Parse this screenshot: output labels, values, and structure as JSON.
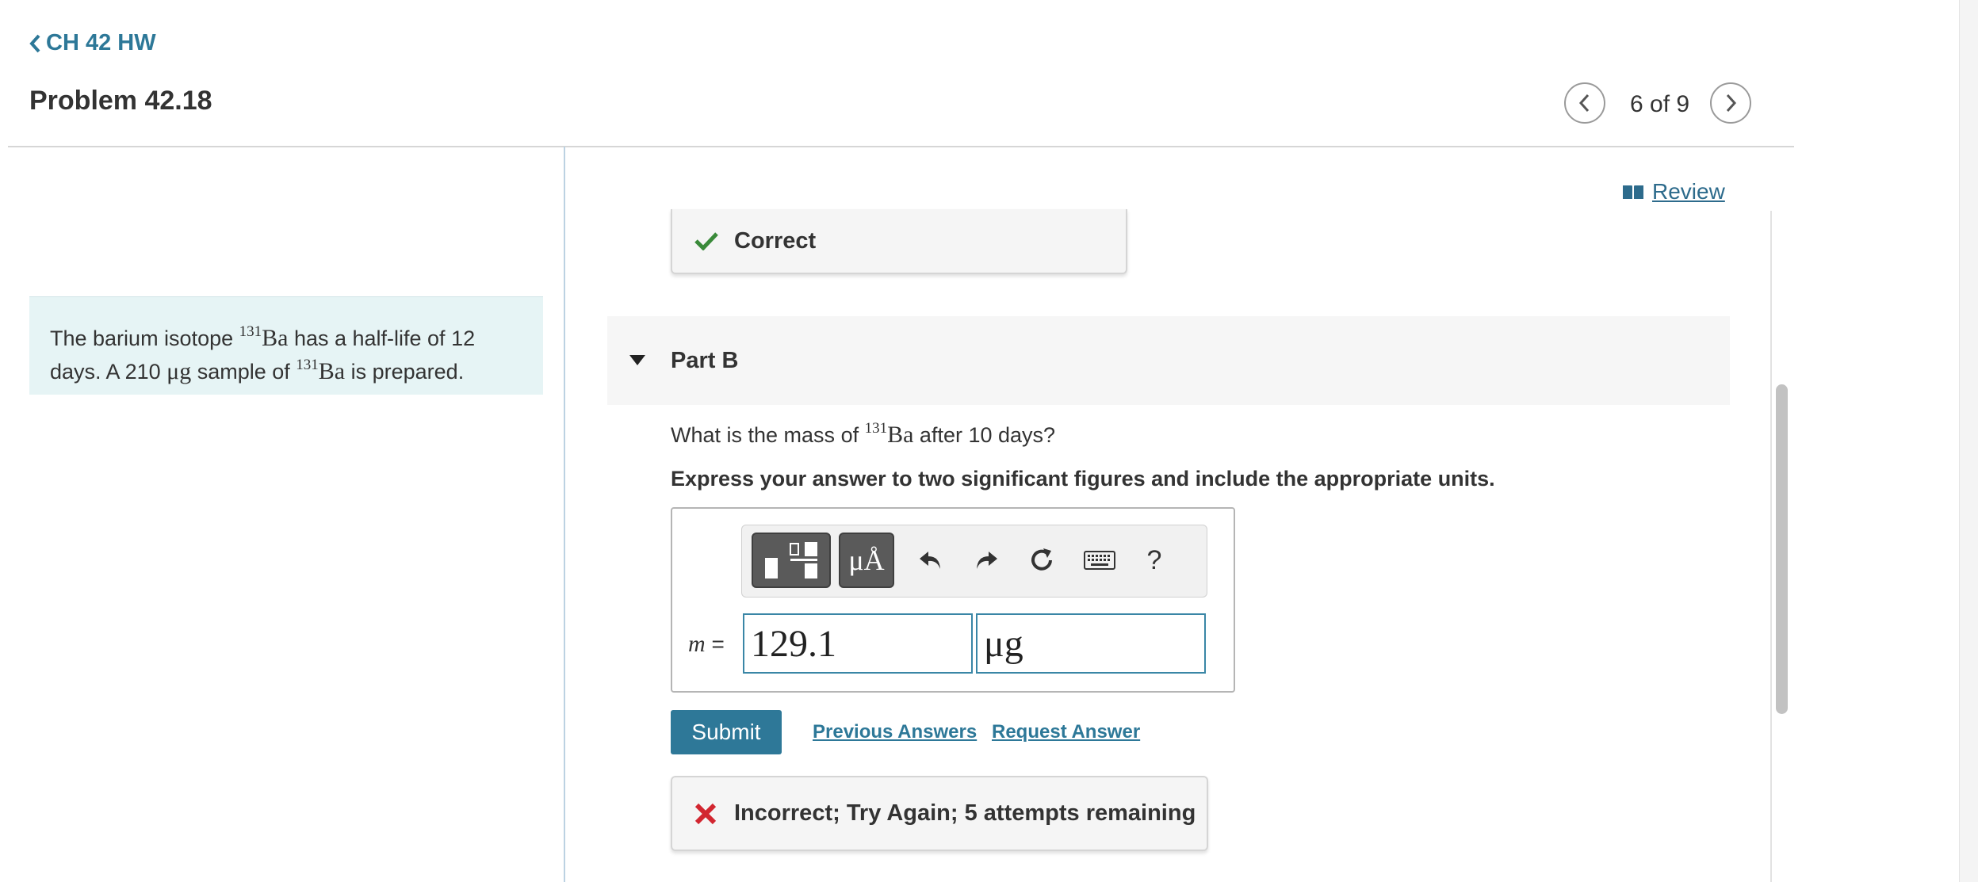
{
  "header": {
    "back_label": "CH 42 HW",
    "problem_title": "Problem 42.18",
    "nav_count": "6 of 9"
  },
  "statement": {
    "t1": "The barium isotope ",
    "iso_mass": "131",
    "iso_sym": "Ba",
    "t2": " has a half-life of 12 days. A 210 ",
    "unit": "μg",
    "t3": " sample of ",
    "t4": " is prepared."
  },
  "review_label": "Review",
  "part_a": {
    "status": "Correct"
  },
  "part_b": {
    "label": "Part B",
    "q1": "What is the mass of ",
    "q_iso_mass": "131",
    "q_iso_sym": "Ba",
    "q2": " after 10 days?",
    "instruction": "Express your answer to two significant figures and include the appropriate units.",
    "toolbar": {
      "units_label": "μÅ",
      "help_label": "?",
      "icons": [
        "templates-icon",
        "units-icon",
        "undo-icon",
        "redo-icon",
        "reset-icon",
        "keyboard-icon",
        "help-icon"
      ]
    },
    "variable": "m",
    "equals": "=",
    "value": "129.1",
    "units_value": "μg",
    "submit_label": "Submit",
    "previous_answers": "Previous Answers",
    "request_answer": "Request Answer",
    "feedback": "Incorrect; Try Again; 5 attempts remaining"
  },
  "colors": {
    "accent": "#2e7898",
    "correct": "#3a8a3a",
    "incorrect": "#d22630",
    "statement_bg": "#e6f4f5"
  }
}
